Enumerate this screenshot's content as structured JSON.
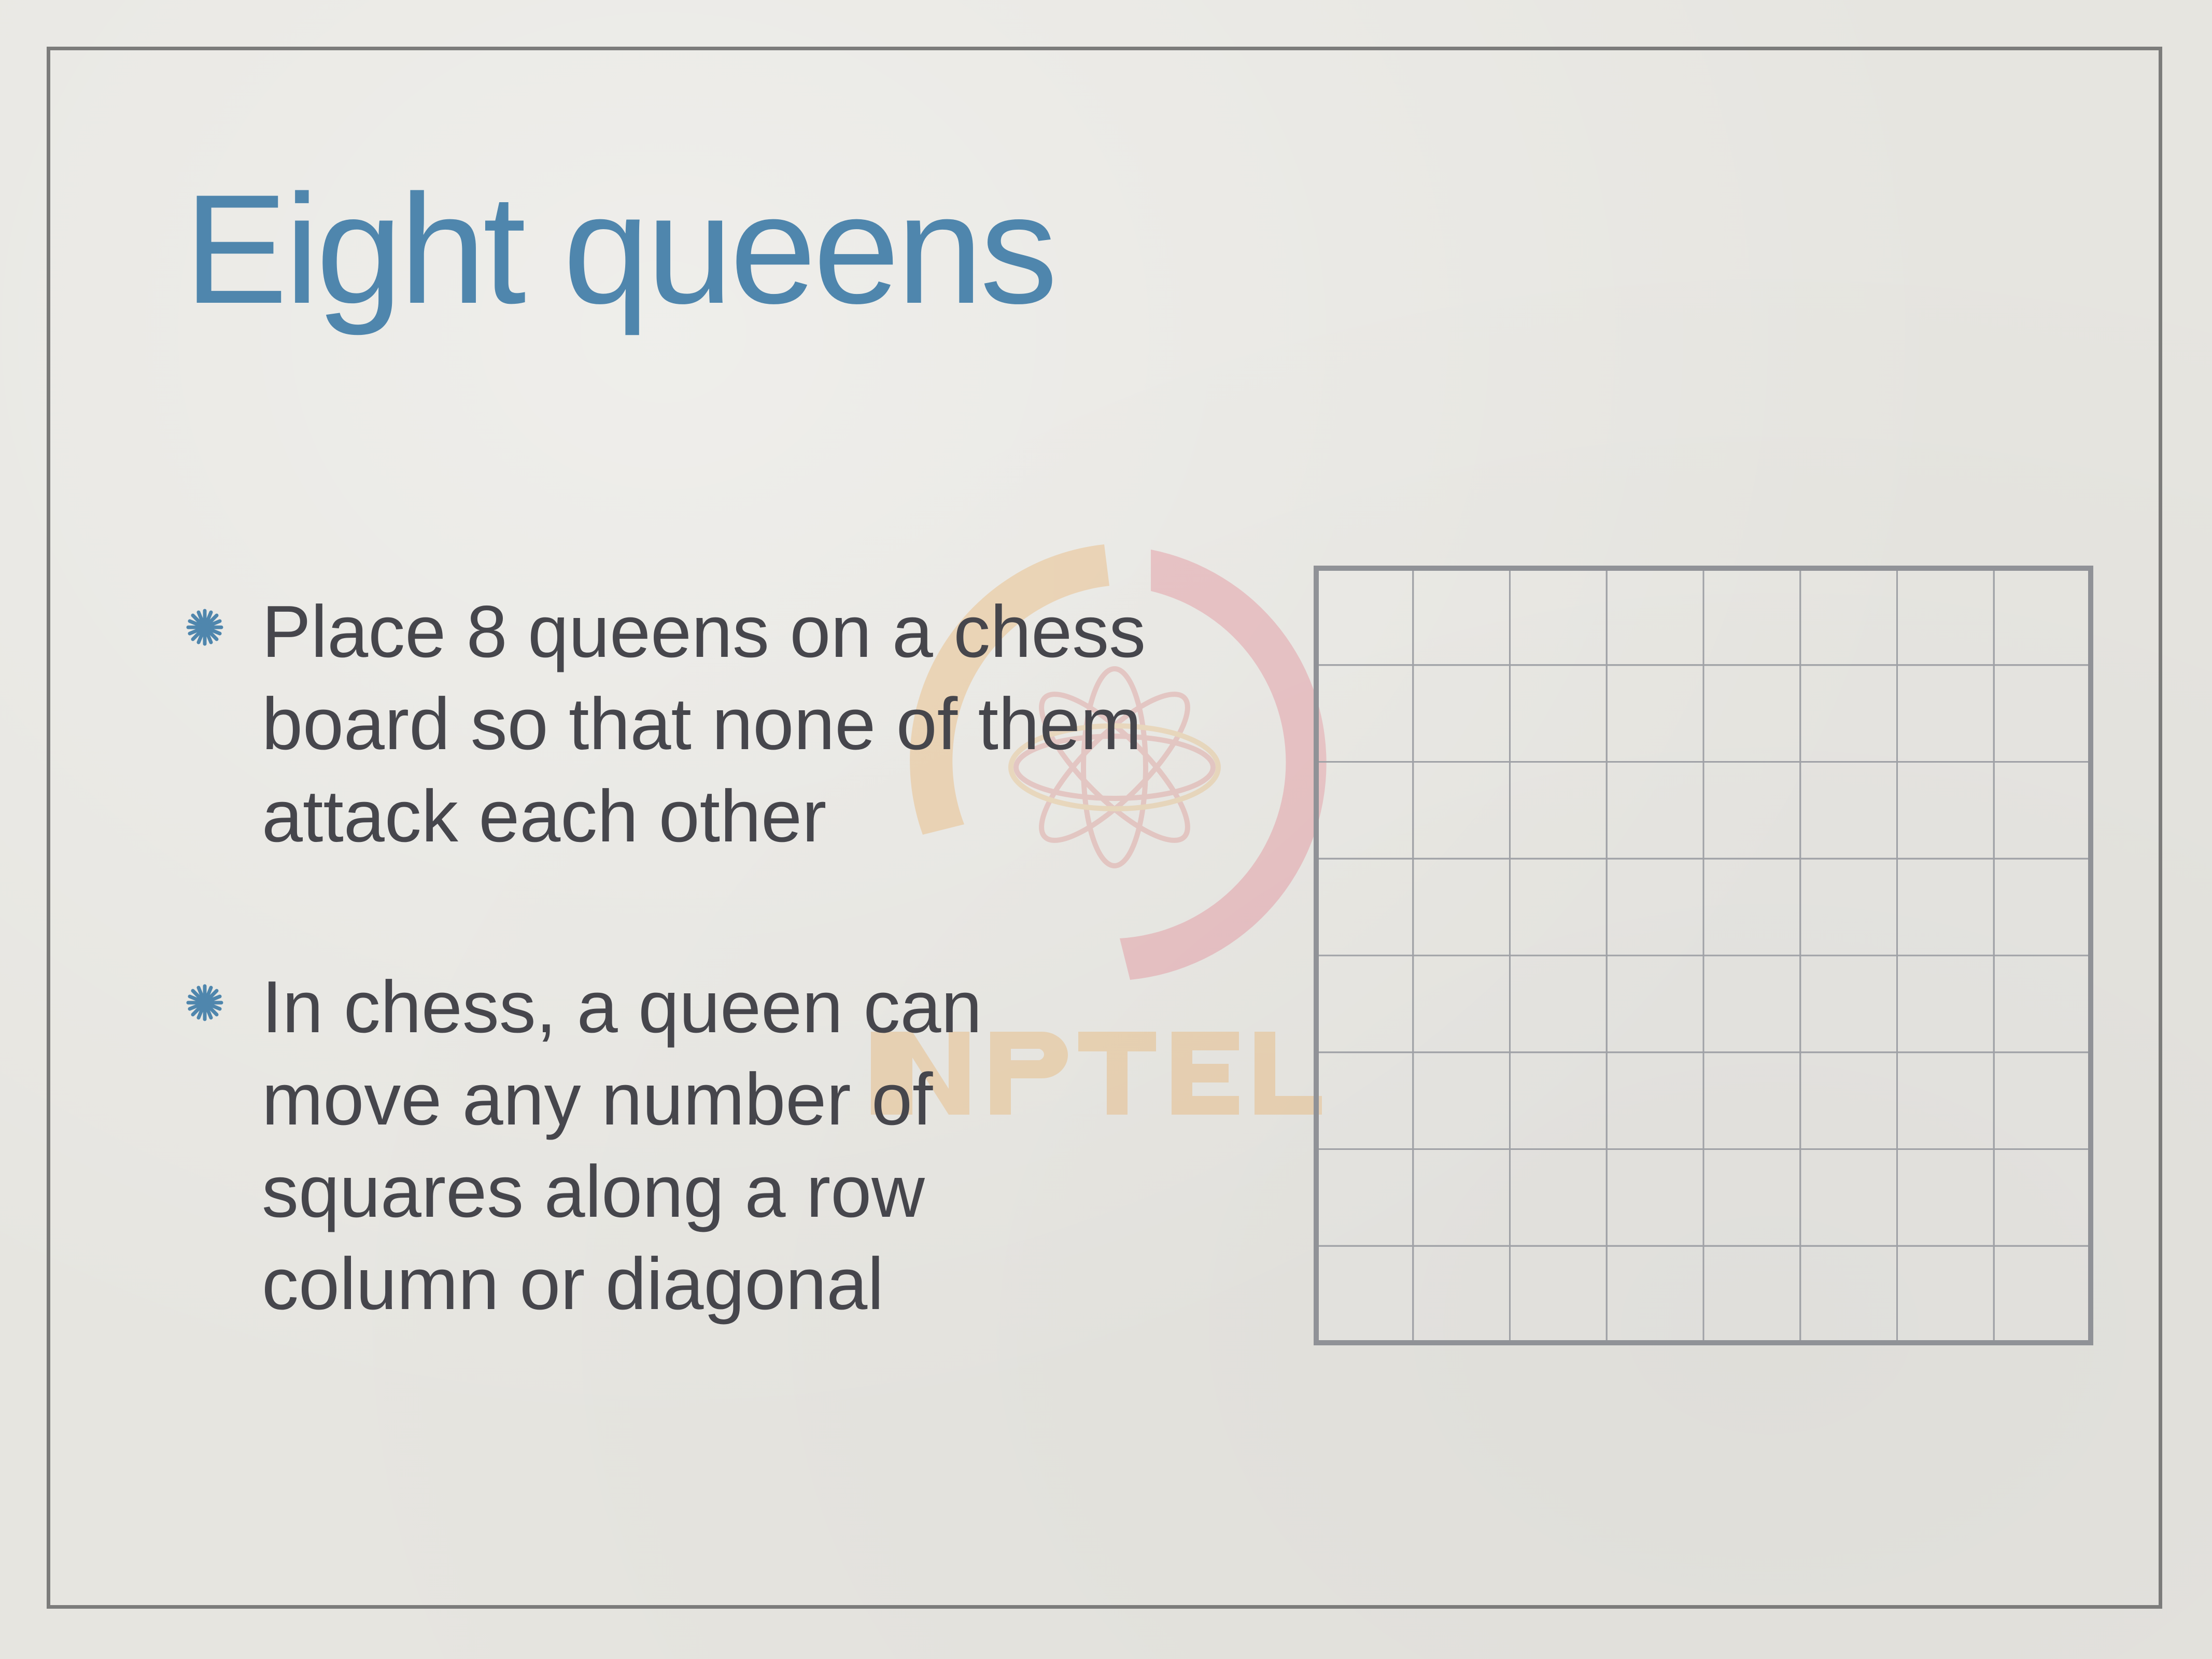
{
  "slide": {
    "title": "Eight queens",
    "bullets": [
      {
        "text": "Place 8 queens on a chess\nboard so that none of them\nattack each other"
      },
      {
        "text": "In chess, a queen can\nmove any number of\nsquares along a row\ncolumn or diagonal"
      }
    ],
    "board": {
      "rows": 8,
      "columns": 8
    },
    "watermark": {
      "text": "NPTEL"
    }
  },
  "colors": {
    "title": "#4f86ad",
    "body_text": "#46464c",
    "frame": "#7c7c7b",
    "board_lines": "#9fa1a6",
    "board_border": "#909297",
    "bullet_marker": "#4f86ad"
  },
  "icons": {
    "bullet": "asterisk-bullet-icon",
    "watermark": "nptel-logo"
  }
}
